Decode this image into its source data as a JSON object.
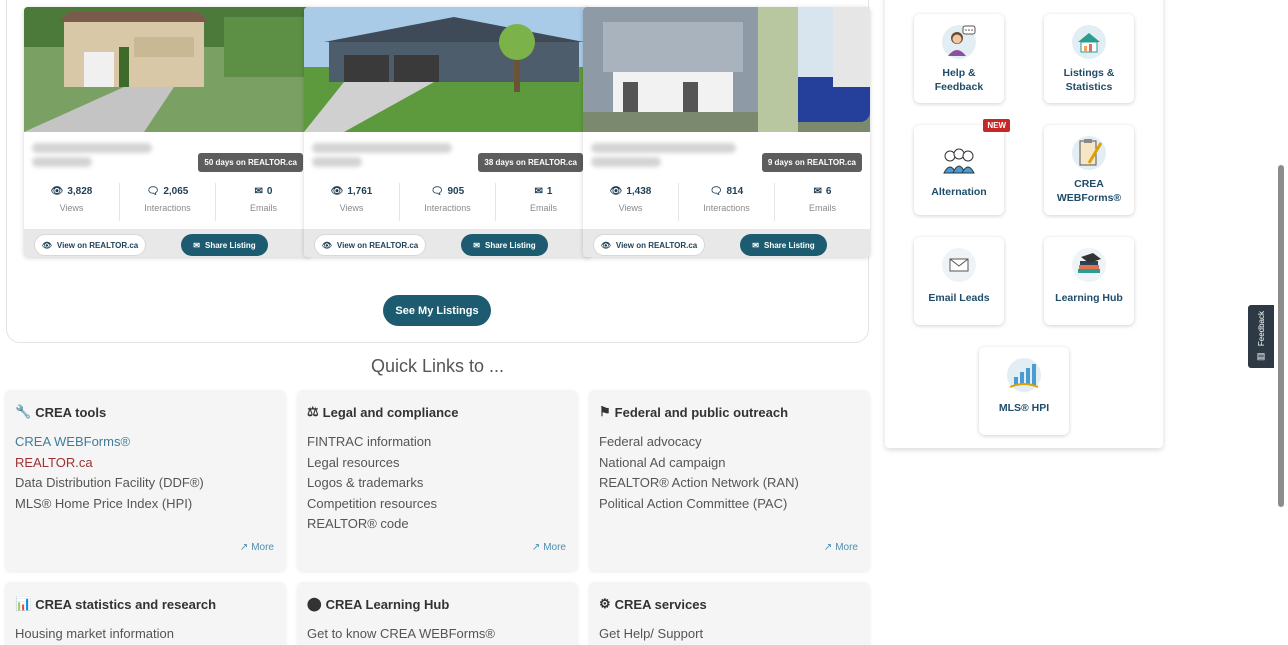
{
  "listings": [
    {
      "days": "50 days on REALTOR.ca",
      "views": "3,828",
      "interactions": "2,065",
      "emails": "0"
    },
    {
      "days": "38 days on REALTOR.ca",
      "views": "1,761",
      "interactions": "905",
      "emails": "1"
    },
    {
      "days": "9 days on REALTOR.ca",
      "views": "1,438",
      "interactions": "814",
      "emails": "6"
    }
  ],
  "listing_labels": {
    "views": "Views",
    "interactions": "Interactions",
    "emails": "Emails",
    "view_btn": "View on REALTOR.ca",
    "share_btn": "Share Listing"
  },
  "see_listings": "See My Listings",
  "quick_links_title": "Quick Links to ...",
  "quick_links": {
    "crea_tools": {
      "title": "CREA tools",
      "items": [
        "CREA WEBForms®",
        "REALTOR.ca",
        "Data Distribution Facility (DDF®)",
        "MLS® Home Price Index (HPI)"
      ],
      "more": "More"
    },
    "legal": {
      "title": "Legal and compliance",
      "items": [
        "FINTRAC information",
        "Legal resources",
        "Logos & trademarks",
        "Competition resources",
        "REALTOR® code"
      ],
      "more": "More"
    },
    "federal": {
      "title": "Federal and public outreach",
      "items": [
        "Federal advocacy",
        "National Ad campaign",
        "REALTOR® Action Network (RAN)",
        "Political Action Committee (PAC)"
      ],
      "more": "More"
    },
    "stats": {
      "title": "CREA statistics and research",
      "items": [
        "Housing market information"
      ]
    },
    "learning": {
      "title": "CREA Learning Hub",
      "items": [
        "Get to know CREA WEBForms®"
      ]
    },
    "services": {
      "title": "CREA services",
      "items": [
        "Get Help/ Support"
      ]
    }
  },
  "tiles": {
    "help": {
      "line1": "Help &",
      "line2": "Feedback"
    },
    "listings_stats": {
      "line1": "Listings &",
      "line2": "Statistics"
    },
    "alternation": {
      "label": "Alternation",
      "badge": "NEW"
    },
    "webforms": {
      "line1": "CREA",
      "line2": "WEBForms®"
    },
    "email_leads": {
      "label": "Email Leads"
    },
    "learning_hub": {
      "label": "Learning Hub"
    },
    "hpi": {
      "label": "MLS® HPI"
    }
  },
  "feedback_tab": "Feedback",
  "colors": {
    "primary": "#1d5c70",
    "link_blue": "#3f7d9a",
    "link_red": "#a03030",
    "badge_red": "#c62828"
  }
}
